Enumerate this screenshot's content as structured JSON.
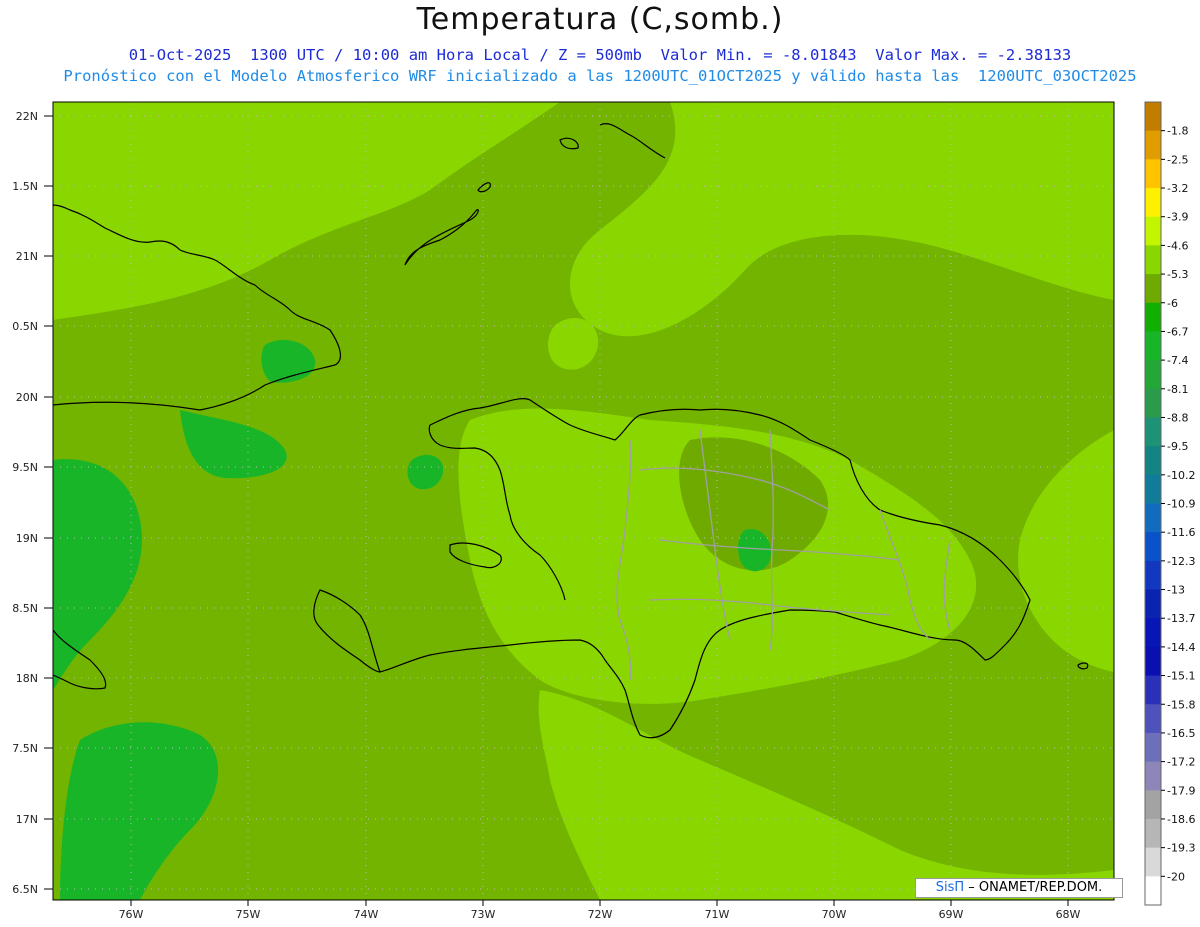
{
  "header": {
    "title": "Temperatura (C,somb.)",
    "line1": "01-Oct-2025  1300 UTC / 10:00 am Hora Local / Z = 500mb  Valor Min. = -8.01843  Valor Max. = -2.38133",
    "line2": "Pronóstico con el Modelo Atmosferico WRF inicializado a las 1200UTC_01OCT2025 y válido hasta las  1200UTC_03OCT2025"
  },
  "axes": {
    "lat_labels": [
      "22N",
      "1.5N",
      "21N",
      "0.5N",
      "20N",
      "9.5N",
      "19N",
      "8.5N",
      "18N",
      "7.5N",
      "17N",
      "6.5N"
    ],
    "lon_labels": [
      "76W",
      "75W",
      "74W",
      "73W",
      "72W",
      "71W",
      "70W",
      "69W",
      "68W"
    ]
  },
  "colorbar": {
    "labels": [
      "-1.8",
      "-2.5",
      "-3.2",
      "-3.9",
      "-4.6",
      "-5.3",
      "-6",
      "-6.7",
      "-7.4",
      "-8.1",
      "-8.8",
      "-9.5",
      "-10.2",
      "-10.9",
      "-11.6",
      "-12.3",
      "-13",
      "-13.7",
      "-14.4",
      "-15.1",
      "-15.8",
      "-16.5",
      "-17.2",
      "-17.9",
      "-18.6",
      "-19.3",
      "-20"
    ],
    "colors": [
      "#c27c00",
      "#e19c00",
      "#ffc300",
      "#fff000",
      "#c2f500",
      "#8ad600",
      "#6faa00",
      "#11b000",
      "#18b529",
      "#23a838",
      "#2a9b4a",
      "#1e9276",
      "#128484",
      "#117b9a",
      "#116cc0",
      "#0a52ca",
      "#1238c0",
      "#0b24b0",
      "#0816b5",
      "#0a10b0",
      "#2a30b8",
      "#4e52bb",
      "#6d6fba",
      "#8e85b9",
      "#a3a3a3",
      "#b6b6b6",
      "#d9d9d9",
      "#ffffff"
    ]
  },
  "credit": {
    "brand": "SisΠ",
    "org": " – ONAMET/REP.DOM."
  },
  "fill_colors": {
    "base": "#7dc200",
    "light": "#8ad600",
    "dark": "#6faa00",
    "green": "#18b529",
    "yellow": "#c2f500"
  }
}
